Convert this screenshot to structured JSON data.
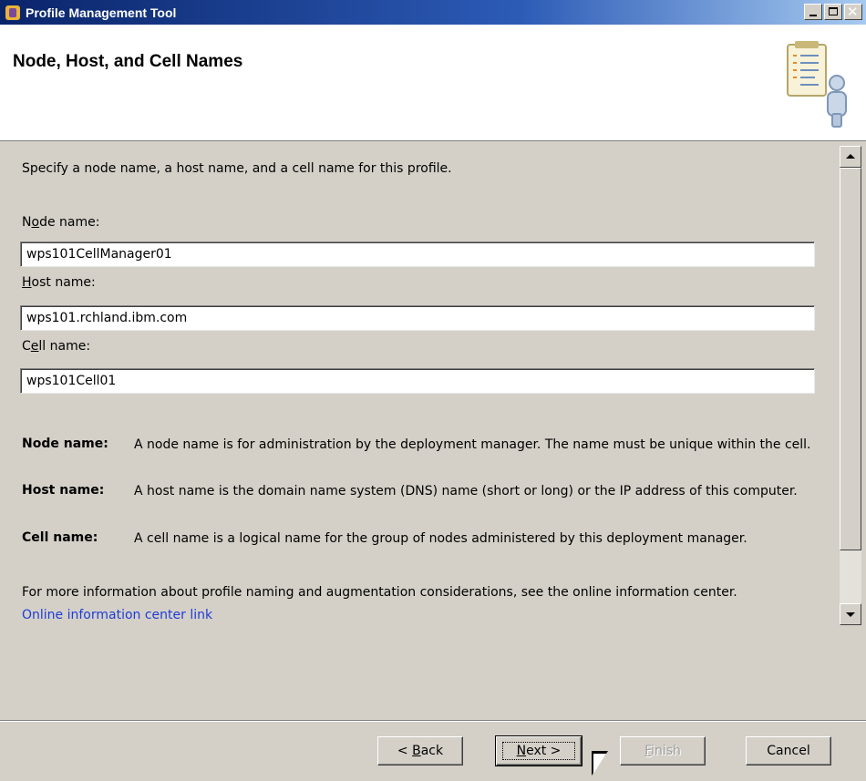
{
  "window": {
    "title": "Profile Management Tool",
    "controls": [
      "minimize-icon",
      "maximize-icon",
      "close-icon"
    ]
  },
  "header": {
    "title": "Node, Host, and Cell Names",
    "icon": "profile-clipboard-user-icon"
  },
  "intro": "Specify a node name, a host name, and a cell name for this profile.",
  "fields": {
    "node": {
      "label_mnemonic": "o",
      "label_pre": "N",
      "label_post": "de name:",
      "value": "wps101CellManager01"
    },
    "host": {
      "label_mnemonic": "H",
      "label_pre": "",
      "label_post": "ost name:",
      "value": "wps101.rchland.ibm.com"
    },
    "cell": {
      "label_mnemonic": "e",
      "label_pre": "C",
      "label_post": "ll name:",
      "value": "wps101Cell01"
    }
  },
  "help": {
    "node": {
      "term": "Node name:",
      "text": "A node name is for administration by the deployment manager. The name must be unique within the cell."
    },
    "host": {
      "term": "Host name:",
      "text": "A host name is the domain name system (DNS) name (short or long) or the IP address of this computer."
    },
    "cell": {
      "term": "Cell name:",
      "text": "A cell name is a logical name for the group of nodes administered by this deployment manager."
    }
  },
  "more_info": "For more information about profile naming and augmentation considerations, see the online information center.",
  "link": "Online information center link",
  "buttons": {
    "back": {
      "pre": "< ",
      "mnemonic": "B",
      "post": "ack"
    },
    "next": {
      "pre": "",
      "mnemonic": "N",
      "post": "ext >"
    },
    "finish": {
      "pre": "",
      "mnemonic": "F",
      "post": "inish"
    },
    "cancel": "Cancel"
  },
  "colors": {
    "title_bar": "#0a246a",
    "dialog_face": "#d4d0c8",
    "link": "#1e3cd6"
  }
}
